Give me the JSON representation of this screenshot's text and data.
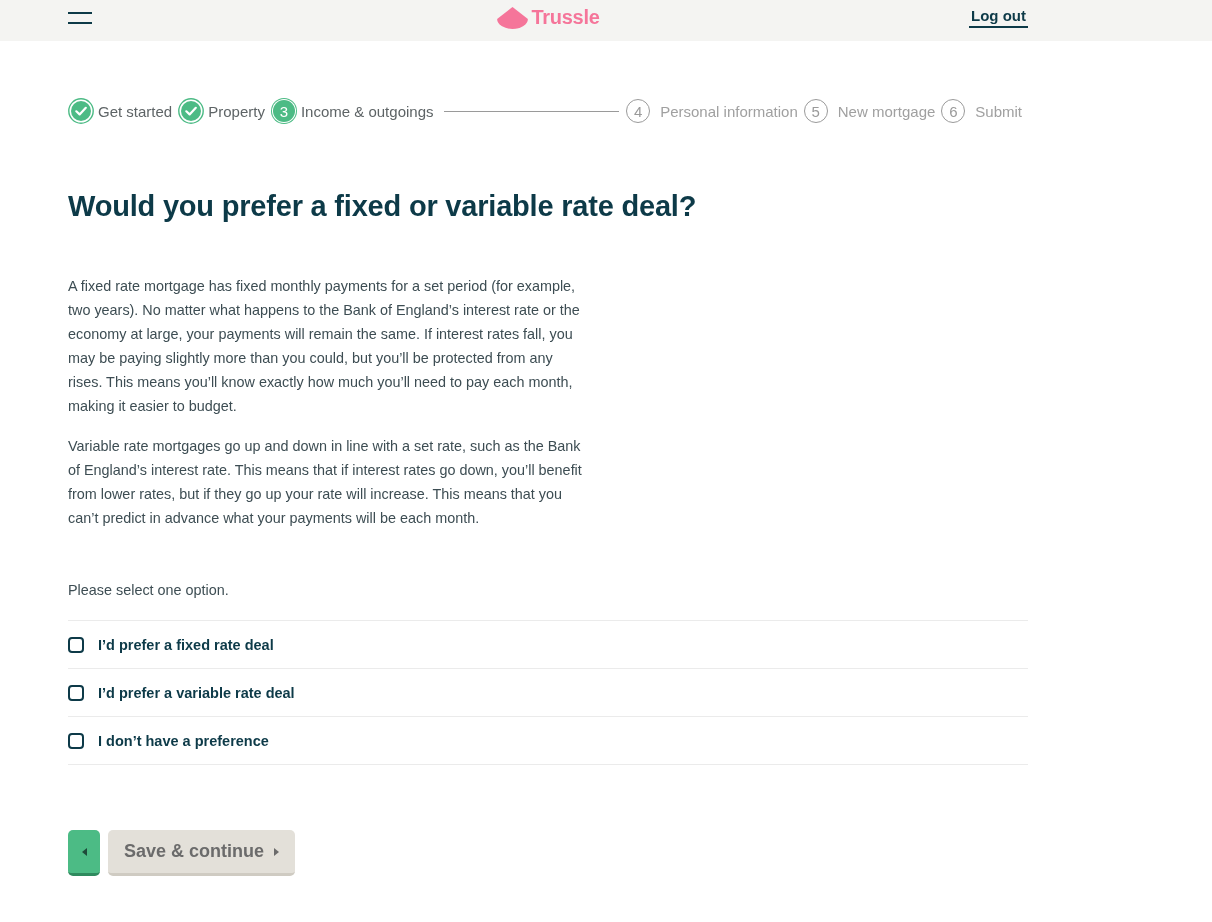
{
  "header": {
    "logo": "Trussle",
    "logout": "Log out"
  },
  "steps": [
    {
      "label": "Get started",
      "kind": "done"
    },
    {
      "label": "Property",
      "kind": "done"
    },
    {
      "number": "3",
      "label": "Income & outgoings",
      "kind": "current"
    },
    {
      "number": "4",
      "label": "Personal information",
      "kind": "todo"
    },
    {
      "number": "5",
      "label": "New mortgage",
      "kind": "todo"
    },
    {
      "number": "6",
      "label": "Submit",
      "kind": "todo"
    }
  ],
  "question": {
    "title": "Would you prefer a fixed or variable rate deal?",
    "paragraphs": [
      "A fixed rate mortgage has fixed monthly payments for a set period (for example, two years). No matter what happens to the Bank of England’s interest rate or the economy at large, your payments will remain the same. If interest rates fall, you may be paying slightly more than you could, but you’ll be protected from any rises. This means you’ll know exactly how much you’ll need to pay each month, making it easier to budget.",
      "Variable rate mortgages go up and down in line with a set rate, such as the Bank of England’s interest rate. This means that if interest rates go down, you’ll benefit from lower rates, but if they go up your rate will increase. This means that you can’t predict in advance what your payments will be each month."
    ],
    "prompt": "Please select one option.",
    "options": [
      {
        "label": "I’d prefer a fixed rate deal",
        "checked": false
      },
      {
        "label": "I’d prefer a variable rate deal",
        "checked": false
      },
      {
        "label": "I don’t have a preference",
        "checked": false
      }
    ]
  },
  "save_button": {
    "label": "Save & continue",
    "disabled": true
  }
}
